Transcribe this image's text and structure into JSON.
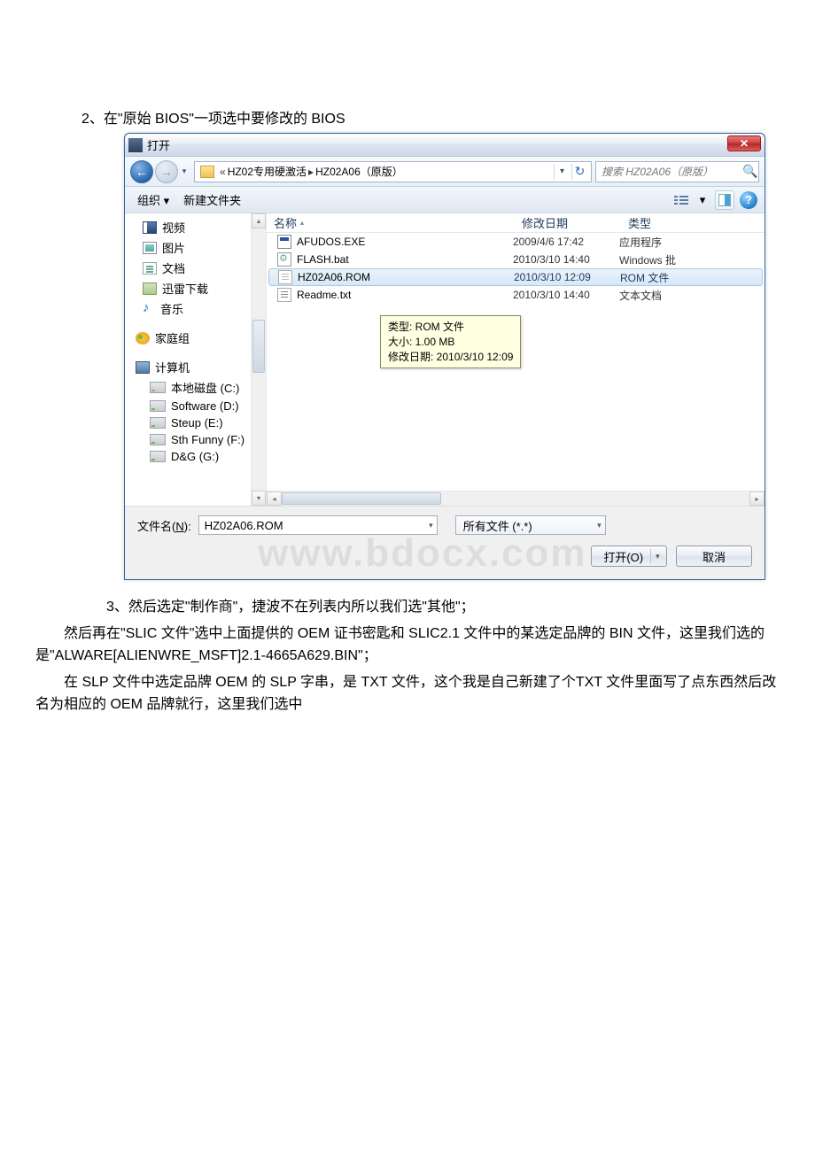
{
  "caption_above": "2、在\"原始 BIOS\"一项选中要修改的 BIOS",
  "dialog": {
    "title": "打开",
    "close_x": "✕",
    "nav": {
      "back_arrow": "←",
      "fwd_arrow": "→",
      "dropdown": "▾",
      "breadcrumb_prefix": "«",
      "breadcrumb_1": "HZ02专用硬激活",
      "breadcrumb_sep": "▸",
      "breadcrumb_2": "HZ02A06（原版）",
      "bc_dd": "▾",
      "refresh": "↻",
      "search_placeholder": "搜索 HZ02A06（原版）",
      "search_icon": "🔍"
    },
    "toolbar": {
      "organize": "组织 ▾",
      "new_folder": "新建文件夹",
      "view_menu_dd": "▾",
      "help": "?"
    },
    "navpane": {
      "video": "视频",
      "pictures": "图片",
      "documents": "文档",
      "xunlei": "迅雷下载",
      "music": "音乐",
      "homegroup": "家庭组",
      "computer": "计算机",
      "drives": [
        "本地磁盘 (C:)",
        "Software (D:)",
        "Steup (E:)",
        "Sth Funny (F:)",
        "D&G (G:)"
      ],
      "scroll_up": "▴",
      "scroll_down": "▾"
    },
    "columns": {
      "name": "名称",
      "sort": "▴",
      "date": "修改日期",
      "type": "类型"
    },
    "files": [
      {
        "name": "AFUDOS.EXE",
        "date": "2009/4/6 17:42",
        "type": "应用程序",
        "icon": "fi-exe",
        "selected": false
      },
      {
        "name": "FLASH.bat",
        "date": "2010/3/10 14:40",
        "type": "Windows 批",
        "icon": "fi-bat",
        "selected": false
      },
      {
        "name": "HZ02A06.ROM",
        "date": "2010/3/10 12:09",
        "type": "ROM 文件",
        "icon": "fi-rom",
        "selected": true
      },
      {
        "name": "Readme.txt",
        "date": "2010/3/10 14:40",
        "type": "文本文档",
        "icon": "fi-txt",
        "selected": false
      }
    ],
    "tooltip": {
      "line1": "类型: ROM 文件",
      "line2": "大小: 1.00 MB",
      "line3": "修改日期: 2010/3/10 12:09"
    },
    "hscroll": {
      "left": "◂",
      "right": "▸",
      "grip": "⋯"
    },
    "footer": {
      "filename_label_pre": "文件名(",
      "filename_label_key": "N",
      "filename_label_post": "):",
      "filename_value": "HZ02A06.ROM",
      "filetype_value": "所有文件 (*.*)",
      "open_label": "打开(O)",
      "cancel_label": "取消",
      "dd": "▾"
    },
    "watermark": "www.bdocx.com"
  },
  "para1": "3、然后选定\"制作商\"，捷波不在列表内所以我们选\"其他\"；",
  "para2": "然后再在\"SLIC 文件\"选中上面提供的 OEM 证书密匙和 SLIC2.1 文件中的某选定品牌的 BIN 文件，这里我们选的是\"ALWARE[ALIENWRE_MSFT]2.1-4665A629.BIN\"；",
  "para3": "在 SLP 文件中选定品牌 OEM 的 SLP 字串，是 TXT 文件，这个我是自己新建了个TXT 文件里面写了点东西然后改名为相应的 OEM 品牌就行，这里我们选中"
}
